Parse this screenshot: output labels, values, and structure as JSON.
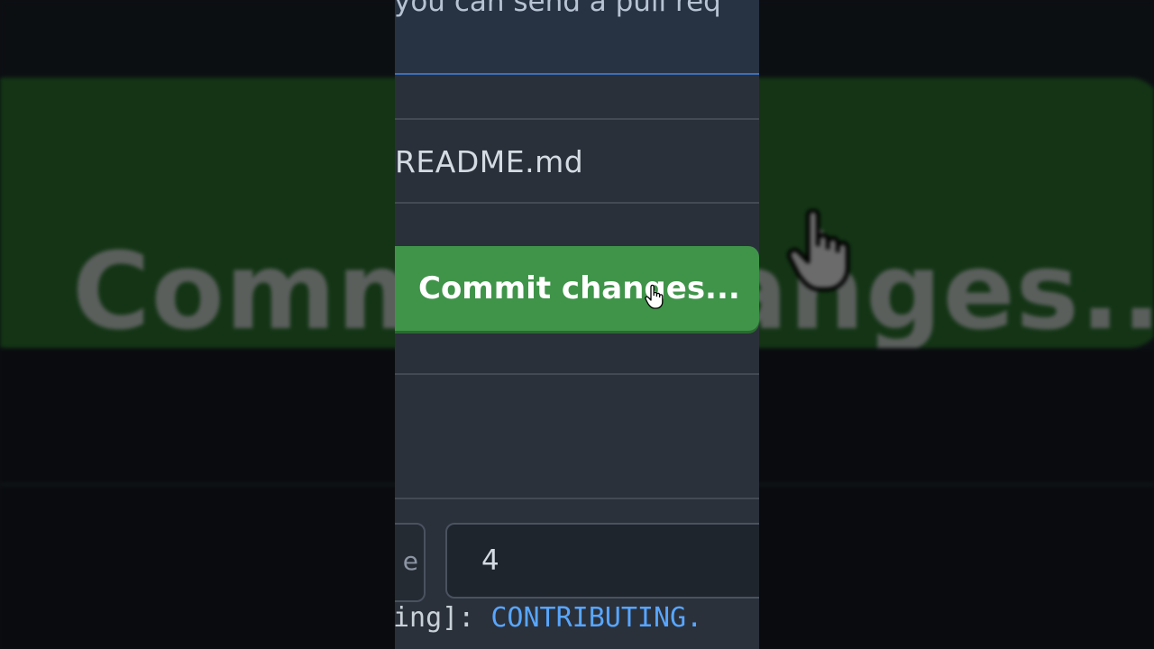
{
  "hint": {
    "text": "you can send a pull req"
  },
  "file": {
    "name": "README.md"
  },
  "commit": {
    "label": "Commit changes..."
  },
  "indent": {
    "size_value": "4",
    "mode_glyph": "e"
  },
  "code": {
    "prefix": "ing]: ",
    "link": "CONTRIBUTING."
  },
  "background": {
    "zoomed_label": "Commit changes..."
  },
  "colors": {
    "commit_green": "#3f9449",
    "focus_blue": "#3d6fb8",
    "panel_bg": "#2a3039",
    "link_blue": "#58a6ff"
  },
  "icons": {
    "cursor": "hand-pointer-icon"
  }
}
